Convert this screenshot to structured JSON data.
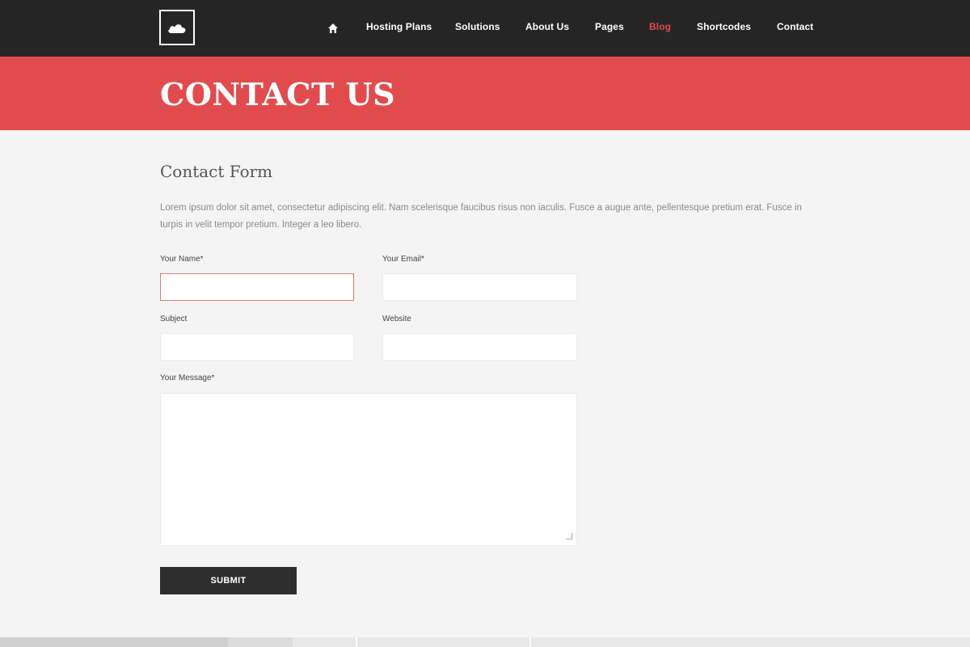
{
  "header": {
    "logo_icon": "cloud-icon",
    "nav": [
      {
        "label": "Hosting Plans"
      },
      {
        "label": "Solutions"
      },
      {
        "label": "About Us"
      },
      {
        "label": "Pages"
      },
      {
        "label": "Blog",
        "active": true
      },
      {
        "label": "Shortcodes"
      },
      {
        "label": "Contact"
      }
    ],
    "home_icon": "home-icon"
  },
  "hero": {
    "title": "CONTACT US"
  },
  "form": {
    "title": "Contact Form",
    "intro": "Lorem ipsum dolor sit amet, consectetur adipiscing elit. Nam scelerisque faucibus risus non iaculis. Fusce a augue ante, pellentesque pretium erat. Fusce in turpis in velit tempor pretium. Integer a leo libero.",
    "name_label": "Your Name*",
    "email_label": "Your Email*",
    "subject_label": "Subject",
    "website_label": "Website",
    "message_label": "Your Message*",
    "name_value": "",
    "email_value": "",
    "subject_value": "",
    "website_value": "",
    "message_value": "",
    "submit_label": "SUBMIT"
  },
  "colors": {
    "accent": "#e24b4d",
    "topbar": "#252525",
    "background": "#f4f4f4"
  }
}
